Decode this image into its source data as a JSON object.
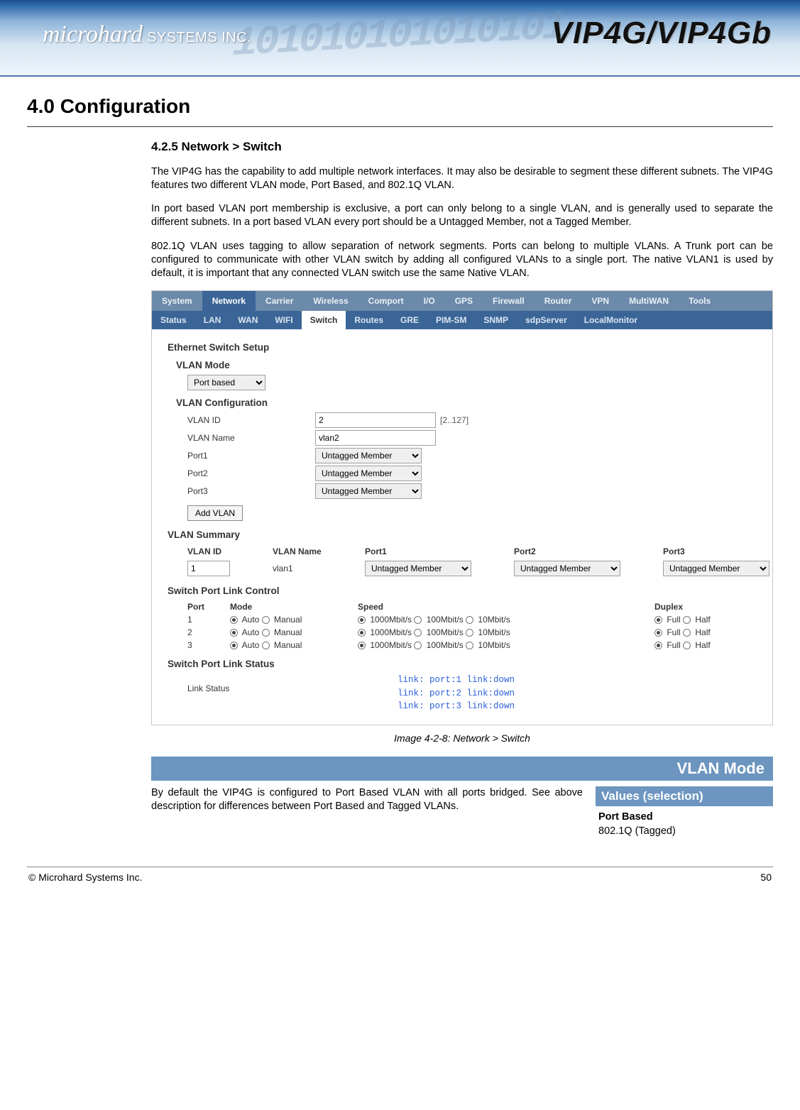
{
  "header": {
    "brand_left": "microhard",
    "brand_left_sub": " SYSTEMS INC.",
    "brand_right": "VIP4G/VIP4Gb",
    "bits": "101010101010101"
  },
  "page": {
    "section_title": "4.0  Configuration",
    "subsection_title": "4.2.5 Network > Switch",
    "para1": "The VIP4G has the capability to add multiple network interfaces. It may also be desirable to segment these different subnets. The VIP4G features two different VLAN mode, Port Based, and 802.1Q VLAN.",
    "para2": "In port based VLAN port membership is exclusive, a port can only belong to a single VLAN, and is generally used to separate the different subnets. In a port based VLAN every port should be a Untagged Member, not a Tagged Member.",
    "para3": "802.1Q VLAN uses tagging to allow separation of network segments. Ports can belong to multiple VLANs. A Trunk port can be configured to communicate with other VLAN switch by  adding all configured VLANs to a single port. The native VLAN1 is used by default, it is important that any connected VLAN switch use the same Native VLAN.",
    "caption": "Image 4-2-8:  Network > Switch"
  },
  "nav_top": [
    "System",
    "Network",
    "Carrier",
    "Wireless",
    "Comport",
    "I/O",
    "GPS",
    "Firewall",
    "Router",
    "VPN",
    "MultiWAN",
    "Tools"
  ],
  "nav_top_active": "Network",
  "nav_sub": [
    "Status",
    "LAN",
    "WAN",
    "WIFI",
    "Switch",
    "Routes",
    "GRE",
    "PIM-SM",
    "SNMP",
    "sdpServer",
    "LocalMonitor"
  ],
  "nav_sub_active": "Switch",
  "switch": {
    "setup_title": "Ethernet Switch Setup",
    "vlan_mode_label": "VLAN Mode",
    "vlan_mode_value": "Port based",
    "vlan_config_title": "VLAN Configuration",
    "vlan_id_label": "VLAN ID",
    "vlan_id_value": "2",
    "vlan_id_hint": "[2..127]",
    "vlan_name_label": "VLAN Name",
    "vlan_name_value": "vlan2",
    "port_member_value": "Untagged Member",
    "port1_label": "Port1",
    "port2_label": "Port2",
    "port3_label": "Port3",
    "add_vlan_btn": "Add VLAN",
    "summary_title": "VLAN Summary",
    "summary_headers": [
      "VLAN ID",
      "VLAN Name",
      "Port1",
      "Port2",
      "Port3"
    ],
    "summary_row": {
      "id": "1",
      "name": "vlan1",
      "p1": "Untagged Member",
      "p2": "Untagged Member",
      "p3": "Untagged Member"
    },
    "linkctl_title": "Switch Port Link Control",
    "linkctl_headers": [
      "Port",
      "Mode",
      "Speed",
      "Duplex"
    ],
    "mode_auto": "Auto",
    "mode_manual": "Manual",
    "speed_1000": "1000Mbit/s",
    "speed_100": "100Mbit/s",
    "speed_10": "10Mbit/s",
    "duplex_full": "Full",
    "duplex_half": "Half",
    "port_nums": [
      "1",
      "2",
      "3"
    ],
    "linkstatus_title": "Switch Port Link Status",
    "linkstatus_label": "Link Status",
    "linkstatus_lines": [
      "link: port:1 link:down",
      "link: port:2 link:down",
      "link: port:3 link:down"
    ]
  },
  "vlan_mode_block": {
    "bar_title": "VLAN Mode",
    "desc": "By default the VIP4G is configured to Port Based VLAN with all ports bridged.  See above description for differences between Port Based and Tagged VLANs.",
    "values_hdr": "Values (selection)",
    "val1": "Port Based",
    "val2": "802.1Q (Tagged)"
  },
  "footer": {
    "left": "© Microhard Systems Inc.",
    "right": "50"
  }
}
